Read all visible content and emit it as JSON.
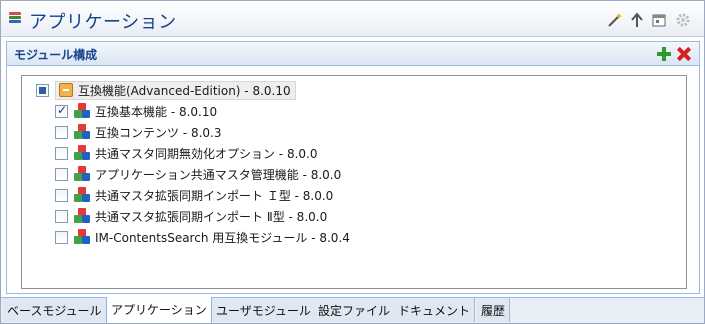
{
  "window": {
    "title": "アプリケーション",
    "icons": [
      "app-stack-icon",
      "magic-wand-icon",
      "arrow-up-icon",
      "calendar-icon",
      "gear-icon"
    ]
  },
  "panel": {
    "title": "モジュール構成",
    "add_icon": "plus-icon",
    "delete_icon": "delete-x-icon",
    "colors": {
      "header_text": "#15428b",
      "add": "#2e9b2e",
      "delete": "#d42020"
    }
  },
  "tree": {
    "root": {
      "label": "互換機能(Advanced-Edition) - 8.0.10",
      "state": "partial",
      "icon": "package-icon"
    },
    "children": [
      {
        "label": "互換基本機能 - 8.0.10",
        "checked": true,
        "icon": "module-icon"
      },
      {
        "label": "互換コンテンツ - 8.0.3",
        "checked": false,
        "icon": "module-icon"
      },
      {
        "label": "共通マスタ同期無効化オプション - 8.0.0",
        "checked": false,
        "icon": "module-icon"
      },
      {
        "label": "アプリケーション共通マスタ管理機能 - 8.0.0",
        "checked": false,
        "icon": "module-icon"
      },
      {
        "label": "共通マスタ拡張同期インポート Ｉ型  - 8.0.0",
        "checked": false,
        "icon": "module-icon"
      },
      {
        "label": "共通マスタ拡張同期インポート Ⅱ型  - 8.0.0",
        "checked": false,
        "icon": "module-icon"
      },
      {
        "label": "IM-ContentsSearch 用互換モジュール - 8.0.4",
        "checked": false,
        "icon": "module-icon"
      }
    ]
  },
  "tabs": [
    {
      "label": "ベースモジュール",
      "active": false
    },
    {
      "label": "アプリケーション",
      "active": true
    },
    {
      "label": "ユーザモジュール",
      "active": false
    },
    {
      "label": "設定ファイル",
      "active": false
    },
    {
      "label": "ドキュメント",
      "active": false
    },
    {
      "label": "履歴",
      "active": false
    }
  ]
}
